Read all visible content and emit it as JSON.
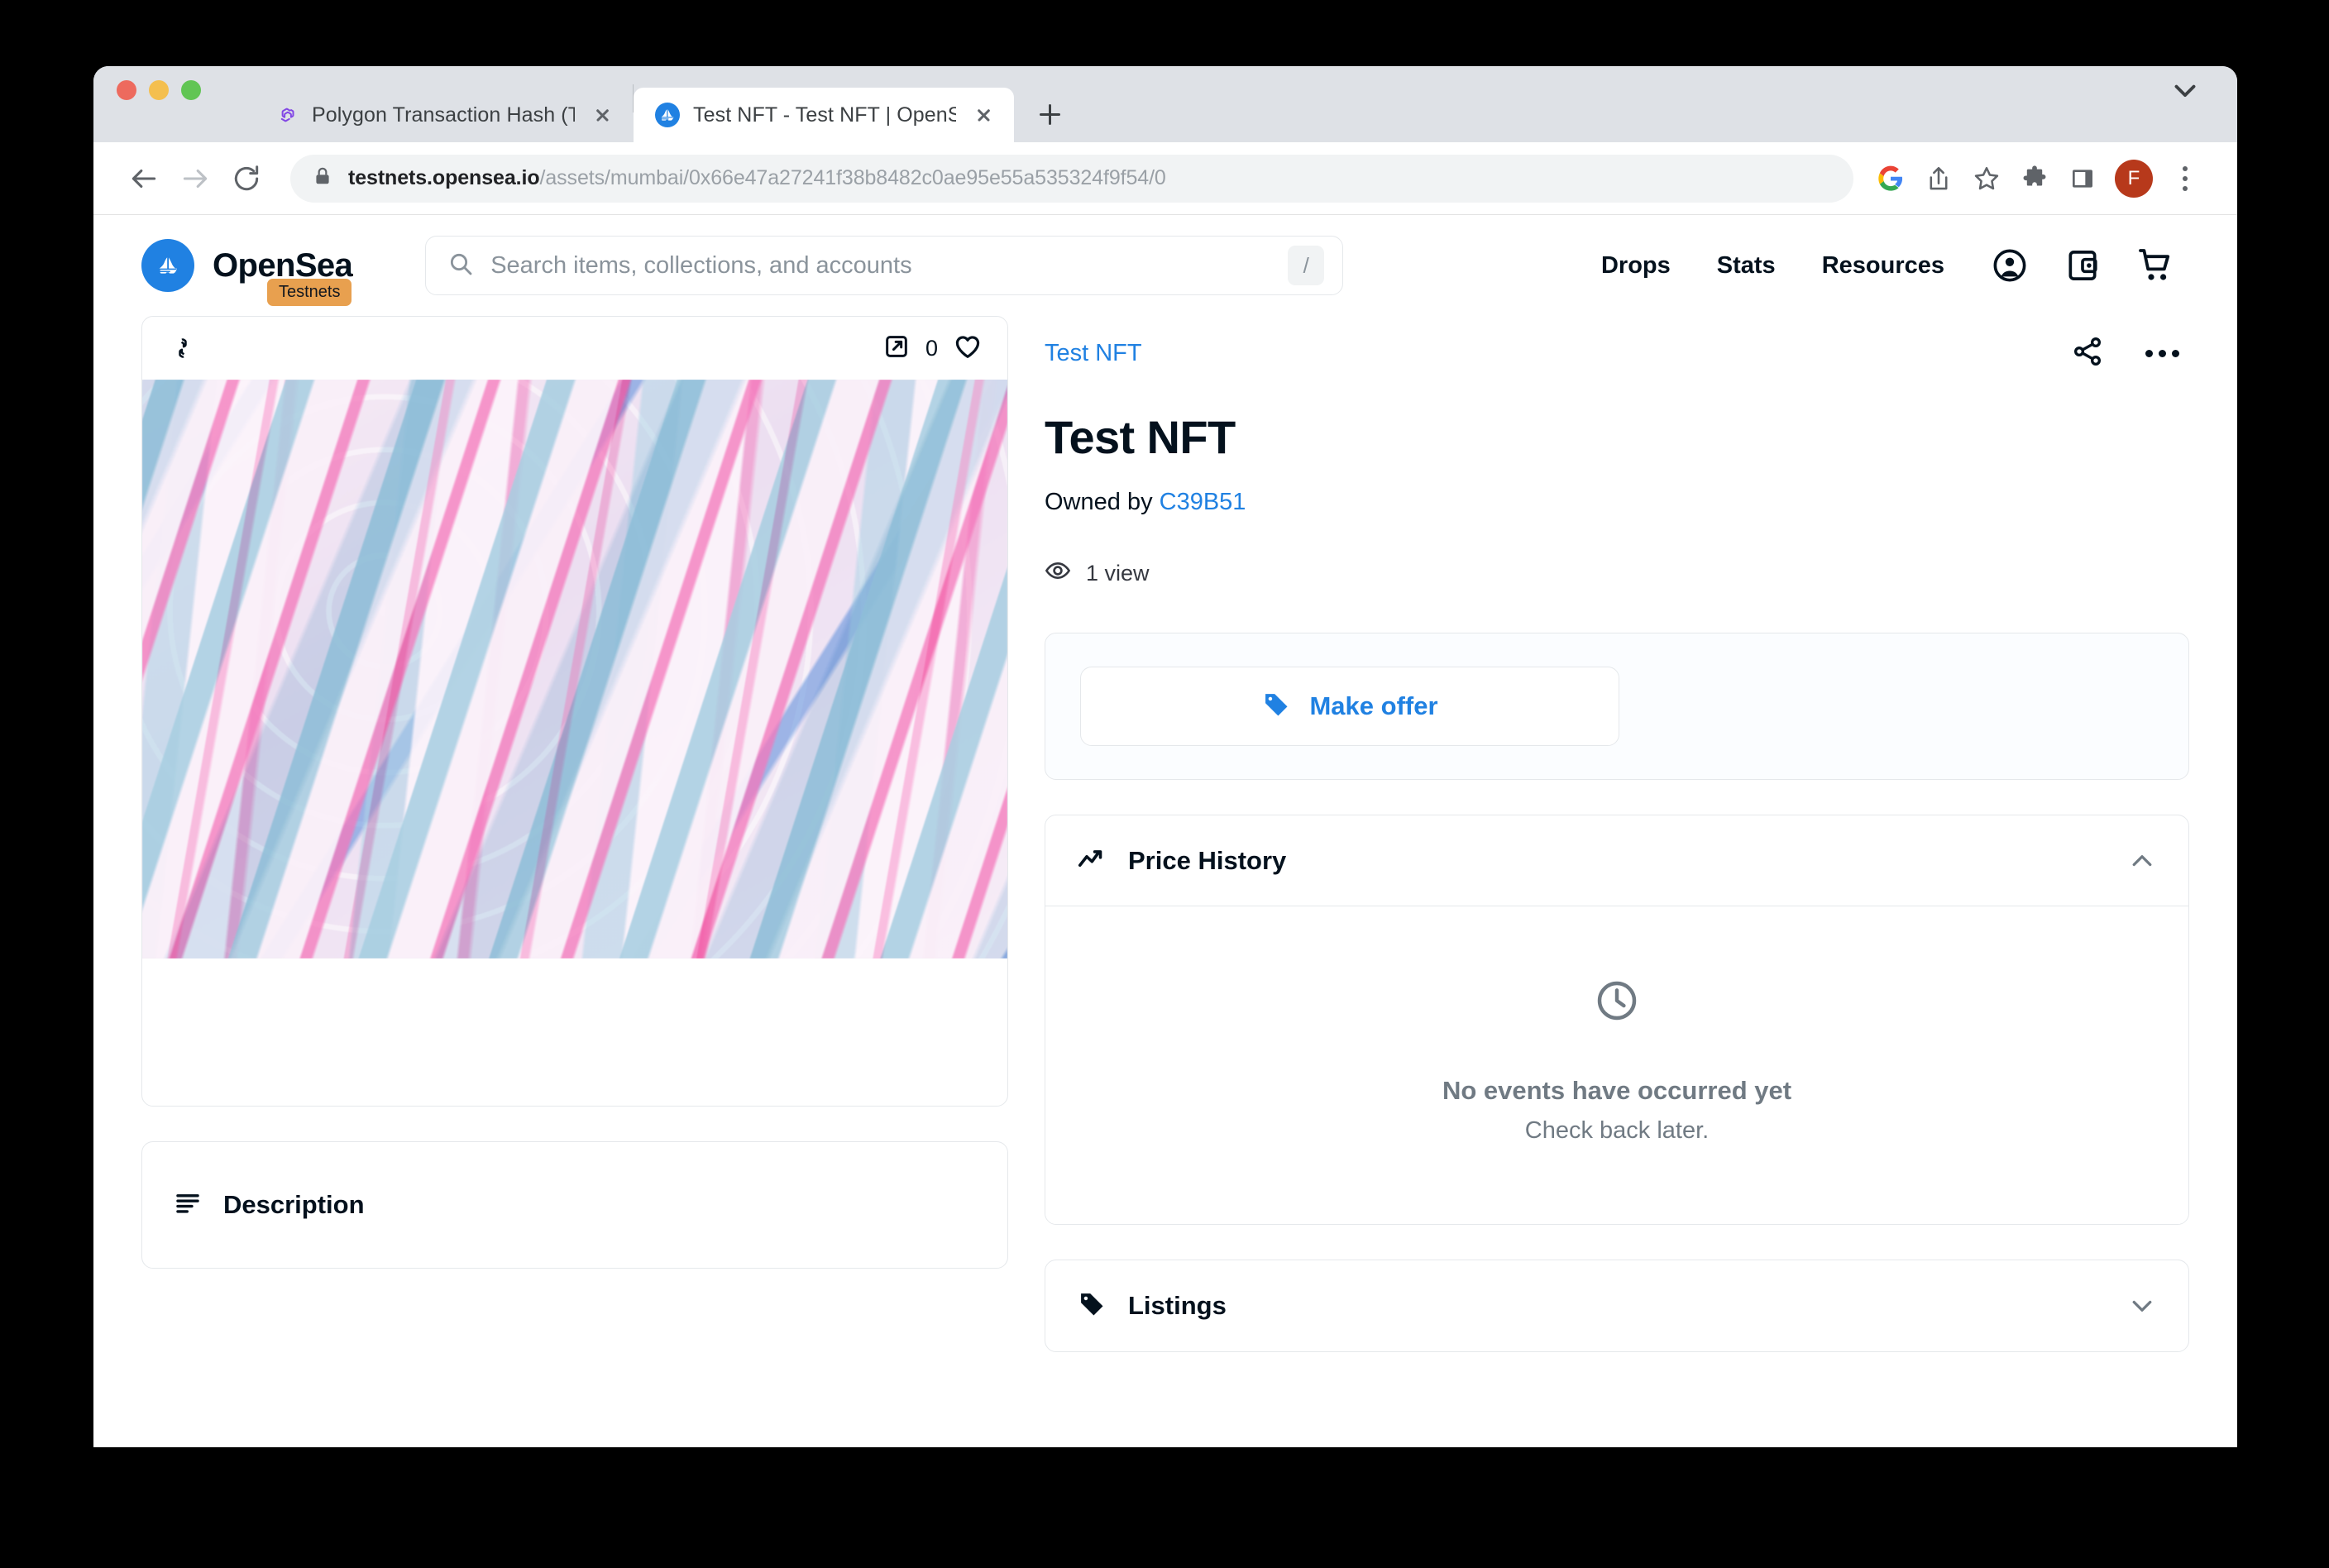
{
  "browser": {
    "tabs": [
      {
        "title": "Polygon Transaction Hash (Txh",
        "favicon": "polygon-icon",
        "active": false
      },
      {
        "title": "Test NFT - Test NFT | OpenSea",
        "favicon": "opensea-icon",
        "active": true
      }
    ],
    "new_tab_label": "+",
    "url_host": "testnets.opensea.io",
    "url_path": "/assets/mumbai/0x66e47a27241f38b8482c0ae95e55a535324f9f54/0",
    "avatar_initial": "F",
    "toolbar_icons": [
      "back-icon",
      "forward-icon",
      "reload-icon",
      "lock-icon",
      "google-lens-icon",
      "share-icon",
      "bookmark-star-icon",
      "extensions-puzzle-icon",
      "side-panel-icon",
      "profile-avatar",
      "chrome-menu-icon"
    ]
  },
  "site_header": {
    "brand": "OpenSea",
    "badge": "Testnets",
    "search_placeholder": "Search items, collections, and accounts",
    "search_value": "",
    "slash_hint": "/",
    "nav_links": [
      "Drops",
      "Stats",
      "Resources"
    ],
    "nav_icons": [
      "account-icon",
      "wallet-icon",
      "cart-icon"
    ]
  },
  "item": {
    "breadcrumb": "Test NFT",
    "title": "Test NFT",
    "owned_by_label": "Owned by",
    "owner": "C39B51",
    "views": "1 view",
    "favorite_count": "0",
    "chain_icon": "polygon-icon",
    "open_external_icon": "open-in-new-icon",
    "favorite_icon": "heart-icon",
    "share_icon": "share-icon",
    "more_icon": "more-horizontal-icon"
  },
  "offer_panel": {
    "button_label": "Make offer",
    "button_icon": "price-tag-icon"
  },
  "price_history": {
    "title": "Price History",
    "icon": "trending-up-icon",
    "expanded": true,
    "chevron": "chevron-up-icon",
    "empty_icon": "clock-icon",
    "empty_title": "No events have occurred yet",
    "empty_subtitle": "Check back later."
  },
  "listings": {
    "title": "Listings",
    "icon": "price-tag-icon",
    "expanded": false,
    "chevron": "chevron-down-icon"
  },
  "description": {
    "title": "Description",
    "icon": "text-lines-icon"
  },
  "colors": {
    "accent_blue": "#2081e2",
    "ink": "#04111d",
    "muted": "#707a83",
    "border": "#e5e8eb",
    "badge_orange": "#e8a04f",
    "avatar_red": "#b7391b"
  }
}
